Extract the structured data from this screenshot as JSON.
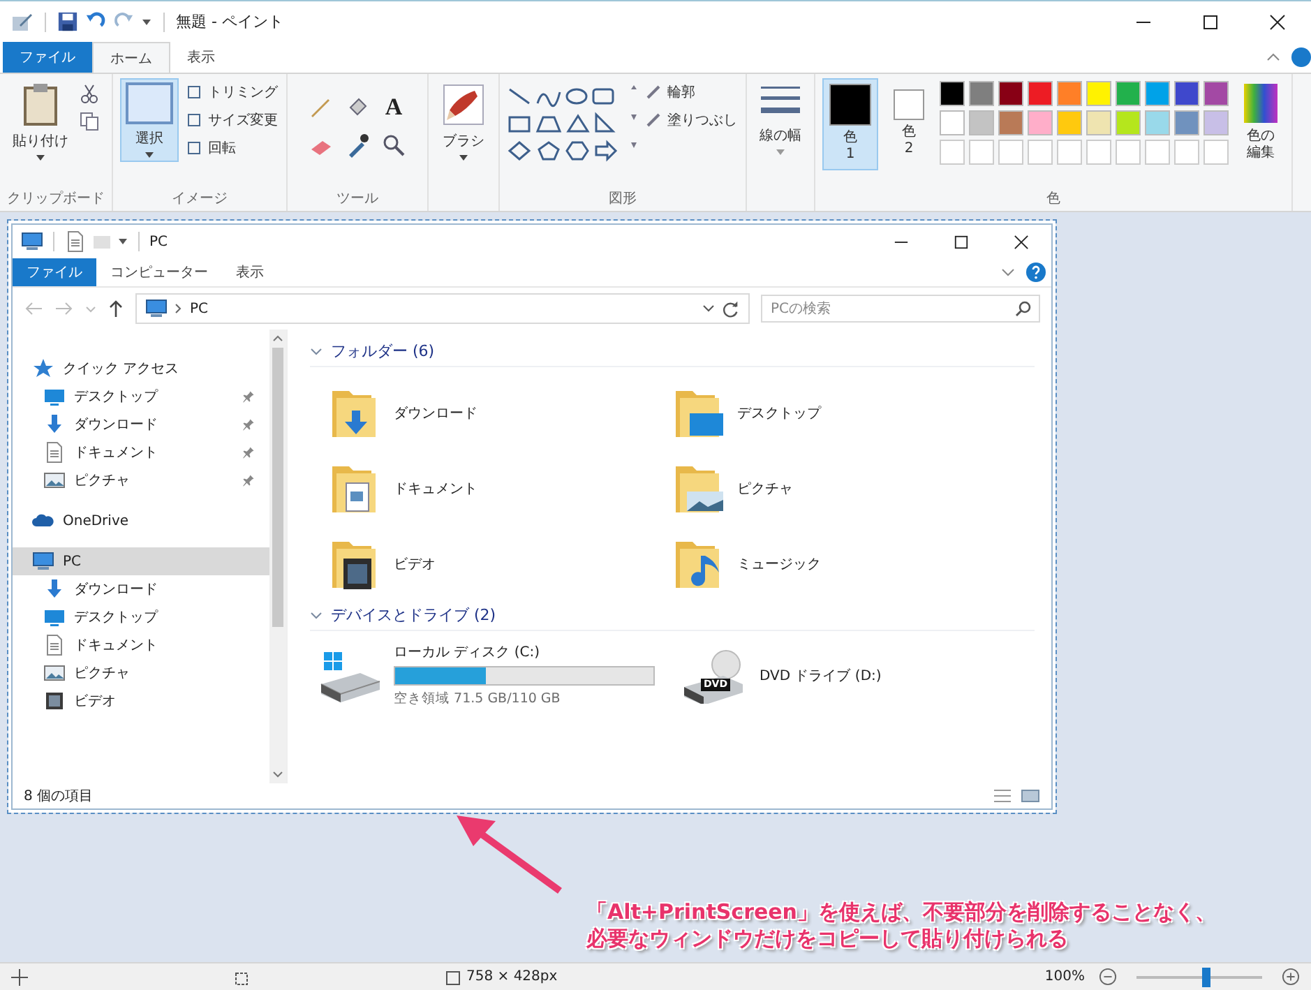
{
  "paint": {
    "title": "無題 - ペイント",
    "ribbon_tabs": [
      {
        "label": "ファイル",
        "kind": "file",
        "selected": false
      },
      {
        "label": "ホーム",
        "kind": "tab",
        "selected": true
      },
      {
        "label": "表示",
        "kind": "tab",
        "selected": false
      }
    ],
    "clipboard": {
      "paste": "貼り付け",
      "label": "クリップボード"
    },
    "image": {
      "select": {
        "label": "選択",
        "selected": true
      },
      "commands": [
        "トリミング",
        "サイズ変更",
        "回転"
      ],
      "label": "イメージ"
    },
    "tools": {
      "text_glyph": "A",
      "label": "ツール"
    },
    "brushes": "ブラシ",
    "shapes": {
      "commands": [
        "輪郭",
        "塗りつぶし"
      ],
      "label": "図形"
    },
    "size": "線の幅",
    "colors": {
      "label": "色",
      "edit": "色の編集",
      "swatches": [
        {
          "label": "色 1",
          "color": "#000000",
          "selected": true
        },
        {
          "label": "色 2",
          "color": "#ffffff",
          "selected": false
        }
      ],
      "palette": [
        {
          "color": "#000000"
        },
        {
          "color": "#7f7f7f"
        },
        {
          "color": "#880015"
        },
        {
          "color": "#ed1c24"
        },
        {
          "color": "#ff7f27"
        },
        {
          "color": "#fff200"
        },
        {
          "color": "#22b14c"
        },
        {
          "color": "#00a2e8"
        },
        {
          "color": "#3f48cc"
        },
        {
          "color": "#a349a4"
        },
        {
          "color": "#ffffff"
        },
        {
          "color": "#c3c3c3"
        },
        {
          "color": "#b97a57"
        },
        {
          "color": "#ffaec9"
        },
        {
          "color": "#ffc90e"
        },
        {
          "color": "#efe4b0"
        },
        {
          "color": "#b5e61d"
        },
        {
          "color": "#99d9ea"
        },
        {
          "color": "#7092be"
        },
        {
          "color": "#c8bfe7"
        }
      ]
    },
    "status_bar": {
      "image_size": "758 × 428px",
      "zoom": "100%",
      "zoom_slider": {
        "level": 0.55
      }
    }
  },
  "explorer": {
    "title": "PC",
    "tabs": [
      {
        "label": "ファイル",
        "kind": "file",
        "selected": false
      },
      {
        "label": "コンピューター",
        "kind": "tab",
        "selected": false
      },
      {
        "label": "表示",
        "kind": "tab",
        "selected": false
      }
    ],
    "address": "PC",
    "search": {
      "placeholder": "PCの検索"
    },
    "nav": [
      {
        "label": "クイック アクセス",
        "selected": false,
        "children": [
          {
            "label": "デスクトップ",
            "pinned": true,
            "selected": false
          },
          {
            "label": "ダウンロード",
            "pinned": true,
            "selected": false
          },
          {
            "label": "ドキュメント",
            "pinned": true,
            "selected": false
          },
          {
            "label": "ピクチャ",
            "pinned": true,
            "selected": false
          }
        ]
      },
      {
        "label": "OneDrive",
        "selected": false
      },
      {
        "label": "PC",
        "selected": true,
        "children": [
          {
            "label": "ダウンロード",
            "pinned": false,
            "selected": false
          },
          {
            "label": "デスクトップ",
            "pinned": false,
            "selected": false
          },
          {
            "label": "ドキュメント",
            "pinned": false,
            "selected": false
          },
          {
            "label": "ピクチャ",
            "pinned": false,
            "selected": false
          },
          {
            "label": "ビデオ",
            "pinned": false,
            "selected": false
          }
        ]
      }
    ],
    "folders": {
      "heading": "フォルダー (6)",
      "items": [
        {
          "name": "ダウンロード"
        },
        {
          "name": "デスクトップ"
        },
        {
          "name": "ドキュメント"
        },
        {
          "name": "ピクチャ"
        },
        {
          "name": "ビデオ"
        },
        {
          "name": "ミュージック"
        }
      ]
    },
    "drives": {
      "heading": "デバイスとドライブ (2)",
      "items": [
        {
          "kind": "disk",
          "name": "ローカル ディスク (C:)",
          "level": 0.35,
          "free": "空き領域 71.5 GB/110 GB"
        },
        {
          "kind": "dvd",
          "name": "DVD ドライブ (D:)",
          "icon_text": "DVD"
        }
      ]
    },
    "status": "8 個の項目"
  },
  "annotation": {
    "lines": [
      "「Alt+PrintScreen」を使えば、不要部分を削除することなく、",
      "必要なウィンドウだけをコピーして貼り付けられる"
    ]
  }
}
